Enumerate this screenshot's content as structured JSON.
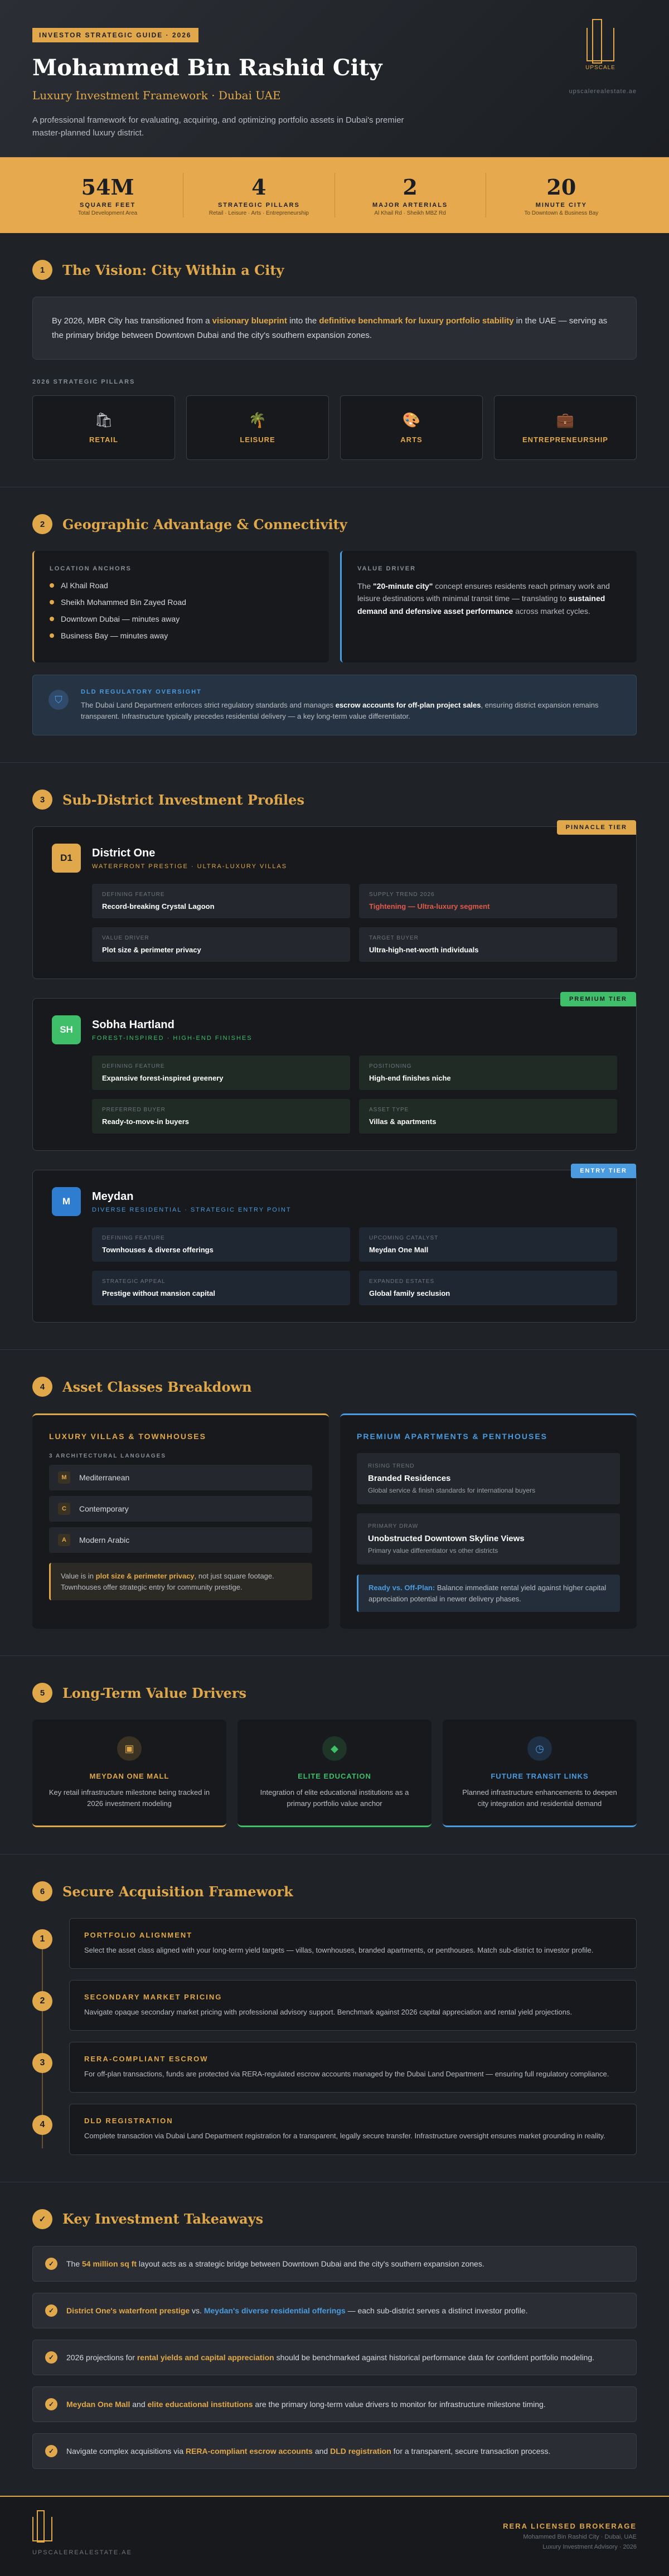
{
  "hero": {
    "tag": "INVESTOR STRATEGIC GUIDE · 2026",
    "title": "Mohammed Bin Rashid City",
    "subtitle": "Luxury Investment Framework · Dubai UAE",
    "description": "A professional framework for evaluating, acquiring, and optimizing portfolio assets in Dubai's premier master-planned luxury district.",
    "brand": "UPSCALE",
    "site": "upscalerealestate.ae"
  },
  "stats": [
    {
      "num": "54M",
      "label": "SQUARE FEET",
      "cap": "Total Development Area"
    },
    {
      "num": "4",
      "label": "STRATEGIC PILLARS",
      "cap": "Retail · Leisure · Arts · Entrepreneurship"
    },
    {
      "num": "2",
      "label": "MAJOR ARTERIALS",
      "cap": "Al Khail Rd · Sheikh MBZ Rd"
    },
    {
      "num": "20",
      "label": "MINUTE CITY",
      "cap": "To Downtown & Business Bay"
    }
  ],
  "s1": {
    "num": "1",
    "title": "The Vision: City Within a City",
    "p1": "By 2026, MBR City has transitioned from a ",
    "h1": "visionary blueprint",
    "p2": " into the ",
    "h2": "definitive benchmark for luxury portfolio stability",
    "p3": " in the UAE — serving as the primary bridge between Downtown Dubai and the city's southern expansion zones.",
    "pillars_label": "2026 STRATEGIC PILLARS",
    "pillars": [
      {
        "icon": "🛍",
        "label": "RETAIL"
      },
      {
        "icon": "🌴",
        "label": "LEISURE"
      },
      {
        "icon": "🎨",
        "label": "ARTS"
      },
      {
        "icon": "💼",
        "label": "ENTREPRENEURSHIP"
      }
    ]
  },
  "s2": {
    "num": "2",
    "title": "Geographic Advantage & Connectivity",
    "anchors_label": "LOCATION ANCHORS",
    "anchors": [
      "Al Khail Road",
      "Sheikh Mohammed Bin Zayed Road",
      "Downtown Dubai — minutes away",
      "Business Bay — minutes away"
    ],
    "driver_label": "VALUE DRIVER",
    "d1": "The ",
    "d2": "\"20-minute city\"",
    "d3": " concept ensures residents reach primary work and leisure destinations with minimal transit time — translating to ",
    "d4": "sustained demand and defensive asset performance",
    "d5": " across market cycles.",
    "ov_label": "DLD REGULATORY OVERSIGHT",
    "ov1": "The Dubai Land Department enforces strict regulatory standards and manages ",
    "ov2": "escrow accounts for off-plan project sales",
    ".": "",
    "ov3": ", ensuring district expansion remains transparent. Infrastructure typically precedes residential delivery — a key long-term value differentiator."
  },
  "s3": {
    "num": "3",
    "title": "Sub-District Investment Profiles",
    "districts": [
      {
        "tier": "PINNACLE TIER",
        "icon": "D1",
        "name": "District One",
        "tag": "WATERFRONT PRESTIGE · ULTRA-LUXURY VILLAS",
        "cells": [
          {
            "k": "DEFINING FEATURE",
            "v": "Record-breaking Crystal Lagoon"
          },
          {
            "k": "SUPPLY TREND 2026",
            "v": "Tightening — Ultra-luxury segment"
          },
          {
            "k": "VALUE DRIVER",
            "v": "Plot size & perimeter privacy"
          },
          {
            "k": "TARGET BUYER",
            "v": "Ultra-high-net-worth individuals"
          }
        ]
      },
      {
        "tier": "PREMIUM TIER",
        "icon": "SH",
        "name": "Sobha Hartland",
        "tag": "FOREST-INSPIRED · HIGH-END FINISHES",
        "cells": [
          {
            "k": "DEFINING FEATURE",
            "v": "Expansive forest-inspired greenery"
          },
          {
            "k": "POSITIONING",
            "v": "High-end finishes niche"
          },
          {
            "k": "PREFERRED BUYER",
            "v": "Ready-to-move-in buyers"
          },
          {
            "k": "ASSET TYPE",
            "v": "Villas & apartments"
          }
        ]
      },
      {
        "tier": "ENTRY TIER",
        "icon": "M",
        "name": "Meydan",
        "tag": "DIVERSE RESIDENTIAL · STRATEGIC ENTRY POINT",
        "cells": [
          {
            "k": "DEFINING FEATURE",
            "v": "Townhouses & diverse offerings"
          },
          {
            "k": "UPCOMING CATALYST",
            "v": "Meydan One Mall"
          },
          {
            "k": "STRATEGIC APPEAL",
            "v": "Prestige without mansion capital"
          },
          {
            "k": "EXPANDED ESTATES",
            "v": "Global family seclusion"
          }
        ]
      }
    ]
  },
  "s4": {
    "num": "4",
    "title": "Asset Classes Breakdown",
    "left_title": "LUXURY VILLAS & TOWNHOUSES",
    "langs_label": "3 ARCHITECTURAL LANGUAGES",
    "langs": [
      {
        "l": "M",
        "t": "Mediterranean"
      },
      {
        "l": "C",
        "t": "Contemporary"
      },
      {
        "l": "A",
        "t": "Modern Arabic"
      }
    ],
    "ln1": "Value is in ",
    "ln2": "plot size & perimeter privacy",
    "ln3": ", not just square footage. Townhouses offer strategic entry for community prestige.",
    "right_title": "PREMIUM APARTMENTS & PENTHOUSES",
    "r": [
      {
        "k": "RISING TREND",
        "v": "Branded Residences",
        "s": "Global service & finish standards for international buyers"
      },
      {
        "k": "PRIMARY DRAW",
        "v": "Unobstructed Downtown Skyline Views",
        "s": "Primary value differentiator vs other districts"
      }
    ],
    "rn1": "Ready vs. Off-Plan:",
    "rn2": " Balance immediate rental yield against higher capital appreciation potential in newer delivery phases."
  },
  "s5": {
    "num": "5",
    "title": "Long-Term Value Drivers",
    "drivers": [
      {
        "icon": "▣",
        "title": "MEYDAN ONE MALL",
        "text": "Key retail infrastructure milestone being tracked in 2026 investment modeling"
      },
      {
        "icon": "◆",
        "title": "ELITE EDUCATION",
        "text": "Integration of elite educational institutions as a primary portfolio value anchor"
      },
      {
        "icon": "◷",
        "title": "FUTURE TRANSIT LINKS",
        "text": "Planned infrastructure enhancements to deepen city integration and residential demand"
      }
    ]
  },
  "s6": {
    "num": "6",
    "title": "Secure Acquisition Framework",
    "steps": [
      {
        "n": "1",
        "t": "PORTFOLIO ALIGNMENT",
        "p": "Select the asset class aligned with your long-term yield targets — villas, townhouses, branded apartments, or penthouses. Match sub-district to investor profile."
      },
      {
        "n": "2",
        "t": "SECONDARY MARKET PRICING",
        "p": "Navigate opaque secondary market pricing with professional advisory support. Benchmark against 2026 capital appreciation and rental yield projections."
      },
      {
        "n": "3",
        "t": "RERA-COMPLIANT ESCROW",
        "p": "For off-plan transactions, funds are protected via RERA-regulated escrow accounts managed by the Dubai Land Department — ensuring full regulatory compliance."
      },
      {
        "n": "4",
        "t": "DLD REGISTRATION",
        "p": "Complete transaction via Dubai Land Department registration for a transparent, legally secure transfer. Infrastructure oversight ensures market grounding in reality."
      }
    ]
  },
  "s7": {
    "icon": "✓",
    "title": "Key Investment Takeaways",
    "t1a": "The ",
    "t1b": "54 million sq ft",
    "t1c": " layout acts as a strategic bridge between Downtown Dubai and the city's southern expansion zones.",
    "t2a": "District One's waterfront prestige",
    "t2b": " vs. ",
    "t2c": "Meydan's diverse residential offerings",
    "t2d": " — each sub-district serves a distinct investor profile.",
    "t3a": "2026 projections for ",
    "t3b": "rental yields and capital appreciation",
    "t3c": " should be benchmarked against historical performance data for confident portfolio modeling.",
    "t4a": "Meydan One Mall",
    "t4b": " and ",
    "t4c": "elite educational institutions",
    "t4d": " are the primary long-term value drivers to monitor for infrastructure milestone timing.",
    "t5a": "Navigate complex acquisitions via ",
    "t5b": "RERA-compliant escrow accounts",
    "t5c": " and ",
    "t5d": "DLD registration",
    "t5e": " for a transparent, secure transaction process."
  },
  "footer": {
    "site": "UPSCALEREALESTATE.AE",
    "title": "RERA LICENSED BROKERAGE",
    "l1": "Mohammed Bin Rashid City · Dubai, UAE",
    "l2": "Luxury Investment Advisory · 2026"
  }
}
